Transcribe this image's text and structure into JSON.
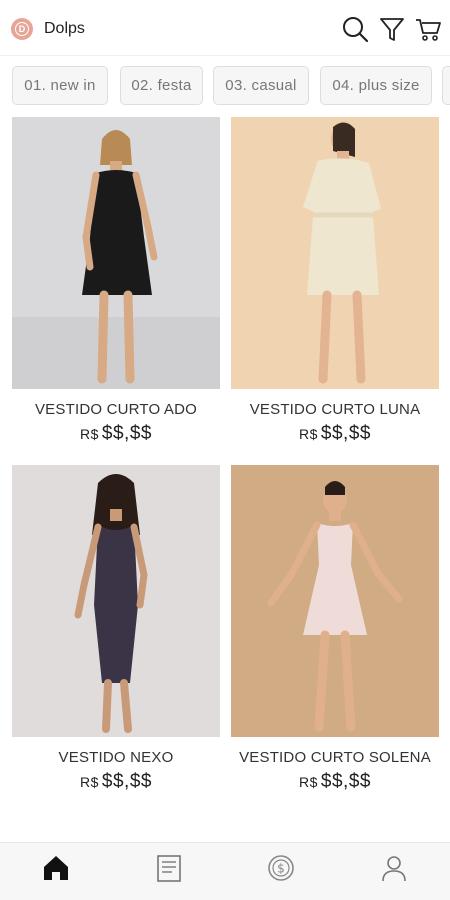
{
  "app": {
    "name": "Dolps",
    "logo_letter": "D"
  },
  "header_icons": [
    "search-icon",
    "filter-icon",
    "cart-icon"
  ],
  "categories": [
    {
      "label": "01. new in"
    },
    {
      "label": "02. festa"
    },
    {
      "label": "03. casual"
    },
    {
      "label": "04. plus size"
    }
  ],
  "products": [
    {
      "name": "VESTIDO CURTO ADO",
      "currency": "R$",
      "price": "$$,$$",
      "bg": "#d9d9db",
      "dress": "#1a1a1a"
    },
    {
      "name": "VESTIDO CURTO LUNA",
      "currency": "R$",
      "price": "$$,$$",
      "bg": "#f0d4b2",
      "dress": "#efe6cf"
    },
    {
      "name": "VESTIDO NEXO",
      "currency": "R$",
      "price": "$$,$$",
      "bg": "#e1dcdc",
      "dress": "#3a3446"
    },
    {
      "name": "VESTIDO CURTO SOLENA",
      "currency": "R$",
      "price": "$$,$$",
      "bg": "#caa27a",
      "dress": "#efdcd8"
    }
  ],
  "bottom_nav": [
    "home-icon",
    "catalog-icon",
    "money-icon",
    "profile-icon"
  ],
  "colors": {
    "logo": "#e6a596",
    "chip_bg": "#f6f6f6",
    "bottom_bar": "#f7f7f7"
  }
}
